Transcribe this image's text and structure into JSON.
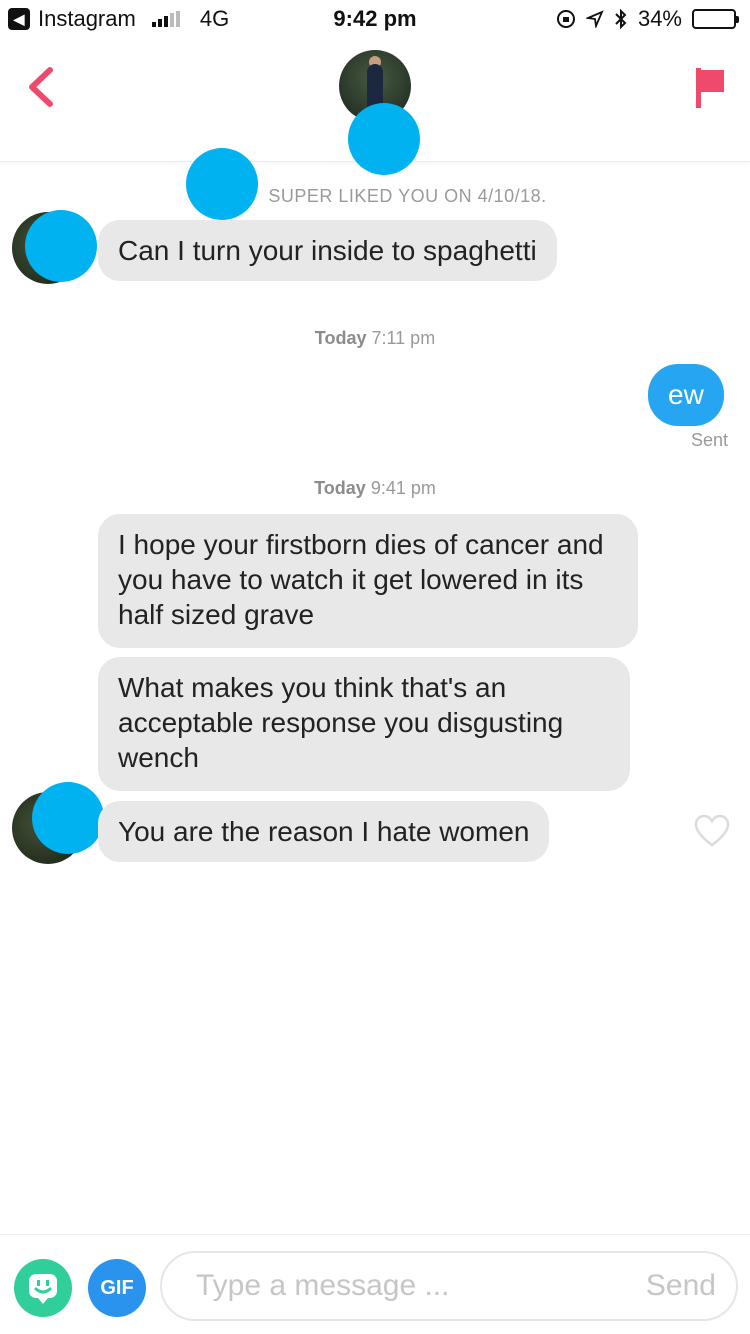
{
  "status_bar": {
    "back_app_label": "Instagram",
    "network": "4G",
    "time": "9:42 pm",
    "battery_percent": "34%",
    "battery_level": 0.34
  },
  "header": {
    "back_icon": "chevron-left-icon",
    "flag_icon": "flag-icon",
    "accent_color": "#ef4a6b"
  },
  "chat": {
    "super_liked_text": "SUPER LIKED YOU ON 4/10/18.",
    "messages_1": [
      {
        "side": "in",
        "text": "Can I turn your inside to spaghetti"
      }
    ],
    "timestamp_1": {
      "day": "Today",
      "time": "7:11 pm"
    },
    "out_message": {
      "text": "ew",
      "status": "Sent"
    },
    "timestamp_2": {
      "day": "Today",
      "time": "9:41 pm"
    },
    "messages_2": [
      {
        "side": "in",
        "text": "I hope your firstborn dies of cancer and you have to watch it get lowered in its half sized grave"
      },
      {
        "side": "in",
        "text": "What makes you think that's an acceptable response you disgusting wench"
      },
      {
        "side": "in",
        "text": "You are the reason I hate women"
      }
    ]
  },
  "composer": {
    "sticker_icon": "sticker-icon",
    "gif_label": "GIF",
    "placeholder": "Type a message ...",
    "send_label": "Send"
  },
  "colors": {
    "outgoing_bubble": "#26a6f2",
    "incoming_bubble": "#e8e8e8",
    "redaction_blob": "#00b2f0",
    "sticker_button": "#2fce9a",
    "gif_button": "#2a93ee"
  }
}
